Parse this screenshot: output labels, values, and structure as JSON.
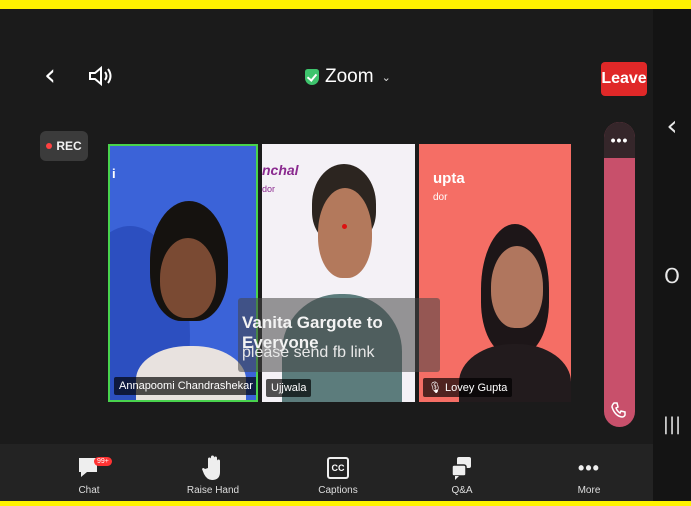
{
  "meeting": {
    "title": "Zoom",
    "leave_label": "Leave",
    "rec_label": "REC"
  },
  "participants": [
    {
      "name": "Annapoomi Chandrashekar"
    },
    {
      "name": "Ujjwala"
    },
    {
      "name": "Lovey Gupta"
    }
  ],
  "tile_brands": {
    "t1": "i",
    "t2": "nchal",
    "t2_sub": "dor",
    "t3": "upta",
    "t3_sub": "dor"
  },
  "chat_overlay": {
    "from": "Vanita Gargote to Everyone",
    "message": "please send fb link"
  },
  "toolbar": {
    "chat_label": "Chat",
    "chat_badge": "99+",
    "raise_hand_label": "Raise Hand",
    "captions_label": "Captions",
    "captions_icon_text": "CC",
    "qa_label": "Q&A",
    "more_label": "More"
  },
  "side_panel": {
    "dots": "•••"
  },
  "system_nav": {
    "back": "‹",
    "home": "O",
    "recents": "|||"
  },
  "colors": {
    "leave": "#e02828",
    "rec_dot": "#ff4141",
    "active_border": "#49d34d",
    "side_panel": "#c8506b",
    "border_yellow": "#fff200"
  }
}
